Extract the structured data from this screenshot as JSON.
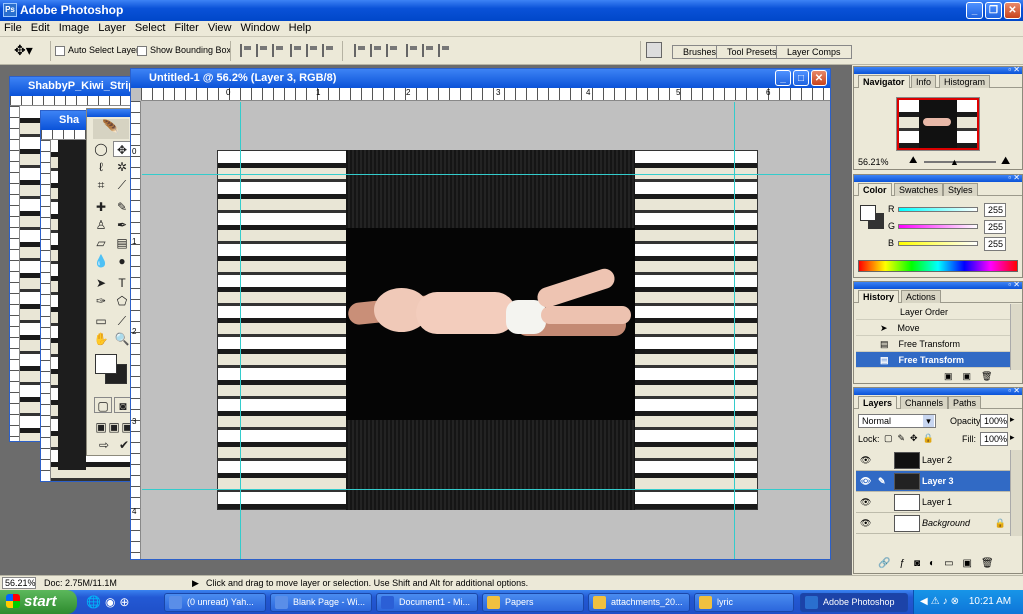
{
  "app": {
    "title": "Adobe Photoshop"
  },
  "menu": [
    "File",
    "Edit",
    "Image",
    "Layer",
    "Select",
    "Filter",
    "View",
    "Window",
    "Help"
  ],
  "options": {
    "auto_select": "Auto Select Layer",
    "show_bbox": "Show Bounding Box"
  },
  "wells": {
    "brushes": "Brushes",
    "tool_presets": "Tool Presets",
    "layer_comps": "Layer Comps"
  },
  "doc_main": {
    "title": "Untitled-1 @ 56.2% (Layer 3, RGB/8)",
    "ruler_h": [
      "0",
      "1",
      "2",
      "3",
      "4",
      "5",
      "6"
    ],
    "ruler_v": [
      "0",
      "1",
      "2",
      "3",
      "4"
    ]
  },
  "doc_back": {
    "title": "ShabbyP_Kiwi_Strip",
    "title2": "Sha"
  },
  "navigator": {
    "tabs": [
      "Navigator",
      "Info",
      "Histogram"
    ],
    "zoom": "56.21%"
  },
  "color": {
    "tabs": [
      "Color",
      "Swatches",
      "Styles"
    ],
    "channels": [
      {
        "label": "R",
        "value": "255"
      },
      {
        "label": "G",
        "value": "255"
      },
      {
        "label": "B",
        "value": "255"
      }
    ]
  },
  "history": {
    "tabs": [
      "History",
      "Actions"
    ],
    "items": [
      "Layer Order",
      "Move",
      "Free Transform",
      "Free Transform"
    ]
  },
  "layers": {
    "tabs": [
      "Layers",
      "Channels",
      "Paths"
    ],
    "blend": "Normal",
    "opacity_label": "Opacity:",
    "opacity": "100%",
    "lock_label": "Lock:",
    "fill_label": "Fill:",
    "fill": "100%",
    "items": [
      "Layer 2",
      "Layer 3",
      "Layer 1",
      "Background"
    ]
  },
  "status": {
    "zoom": "56.21%",
    "doc": "Doc: 2.75M/11.1M",
    "hint": "Click and drag to move layer or selection.  Use Shift and Alt for additional options."
  },
  "taskbar": {
    "start": "start",
    "tasks": [
      "(0 unread) Yah...",
      "Blank Page - Wi...",
      "Document1 - Mi...",
      "Papers",
      "attachments_20...",
      "lyric",
      "Adobe Photoshop"
    ],
    "clock": "10:21 AM"
  }
}
